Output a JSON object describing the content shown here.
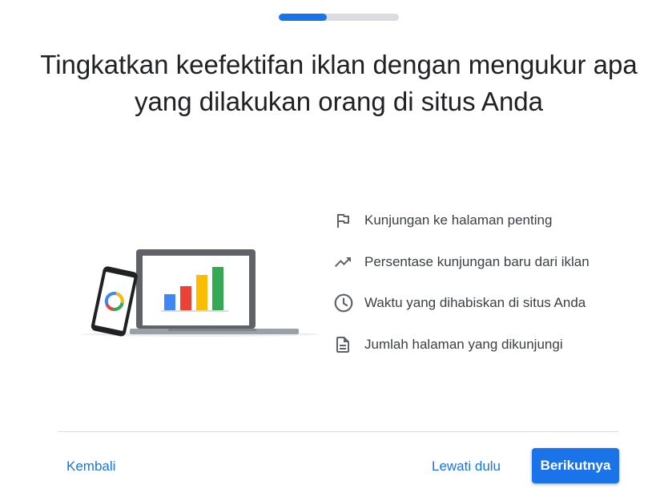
{
  "progress": {
    "fraction": 0.4
  },
  "title": "Tingkatkan keefektifan iklan dengan mengukur apa yang dilakukan orang di situs Anda",
  "features": [
    {
      "icon": "flag-icon",
      "label": "Kunjungan ke halaman penting"
    },
    {
      "icon": "trending-up-icon",
      "label": "Persentase kunjungan baru dari iklan"
    },
    {
      "icon": "clock-icon",
      "label": "Waktu yang dihabiskan di situs Anda"
    },
    {
      "icon": "document-icon",
      "label": "Jumlah halaman yang dikunjungi"
    }
  ],
  "footer": {
    "back_label": "Kembali",
    "skip_label": "Lewati dulu",
    "next_label": "Berikutnya"
  },
  "colors": {
    "accent": "#1a73e8",
    "illustration_bars": [
      "#4285f4",
      "#ea4335",
      "#fbbc04",
      "#34a853"
    ]
  }
}
